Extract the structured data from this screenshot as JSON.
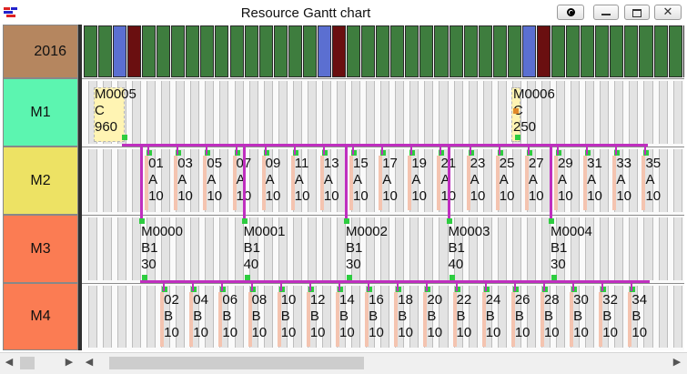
{
  "window": {
    "title": "Resource Gantt chart",
    "icons": [
      "app-icon",
      "diamond-icon",
      "minimize-icon",
      "maximize-icon",
      "close-icon"
    ]
  },
  "rows": [
    {
      "label": "2016",
      "color": "#b5865f"
    },
    {
      "label": "M1",
      "color": "#5cf5b0"
    },
    {
      "label": "M2",
      "color": "#ede264"
    },
    {
      "label": "M3",
      "color": "#fb7c53"
    },
    {
      "label": "M4",
      "color": "#fb7c53"
    }
  ],
  "calendar": {
    "colors": {
      "work": "#3e7d3e",
      "blue": "#5b6fd1",
      "maroon": "#6a0f10"
    },
    "pattern": [
      "work",
      "work",
      "blue",
      "maroon",
      "work",
      "work",
      "work",
      "work",
      "work",
      "work",
      "work",
      "work",
      "work",
      "work",
      "work",
      "work",
      "blue",
      "maroon",
      "work",
      "work",
      "work",
      "work",
      "work",
      "work",
      "work",
      "work",
      "work",
      "work",
      "work",
      "work",
      "blue",
      "maroon",
      "work",
      "work",
      "work",
      "work",
      "work",
      "work",
      "work",
      "work",
      "work",
      "work",
      "work",
      "work",
      "blue",
      "maroon",
      "work",
      "work",
      "work",
      "work",
      "work",
      "work",
      "work",
      "work",
      "work",
      "work",
      "work",
      "work",
      "blue",
      "maroon",
      "work",
      "work",
      "work",
      "work",
      "work",
      "work",
      "work",
      "work",
      "work",
      "work",
      "work",
      "work",
      "blue",
      "maroon",
      "work",
      "work",
      "work",
      "work",
      "work",
      "work",
      "work",
      "work",
      "work",
      "work",
      "work"
    ]
  },
  "jobs": {
    "m1": [
      {
        "lines": [
          "M0005",
          "C",
          "960"
        ]
      },
      {
        "lines": [
          "M0006",
          "C",
          "250"
        ]
      }
    ],
    "m2": [
      {
        "lines": [
          "01",
          "A",
          "10"
        ]
      },
      {
        "lines": [
          "03",
          "A",
          "10"
        ]
      },
      {
        "lines": [
          "05",
          "A",
          "10"
        ]
      },
      {
        "lines": [
          "07",
          "A",
          "10"
        ]
      },
      {
        "lines": [
          "09",
          "A",
          "10"
        ]
      },
      {
        "lines": [
          "11",
          "A",
          "10"
        ]
      },
      {
        "lines": [
          "13",
          "A",
          "10"
        ]
      },
      {
        "lines": [
          "15",
          "A",
          "10"
        ]
      },
      {
        "lines": [
          "17",
          "A",
          "10"
        ]
      },
      {
        "lines": [
          "19",
          "A",
          "10"
        ]
      },
      {
        "lines": [
          "21",
          "A",
          "10"
        ]
      },
      {
        "lines": [
          "23",
          "A",
          "10"
        ]
      },
      {
        "lines": [
          "25",
          "A",
          "10"
        ]
      },
      {
        "lines": [
          "27",
          "A",
          "10"
        ]
      },
      {
        "lines": [
          "29",
          "A",
          "10"
        ]
      },
      {
        "lines": [
          "31",
          "A",
          "10"
        ]
      },
      {
        "lines": [
          "33",
          "A",
          "10"
        ]
      },
      {
        "lines": [
          "35",
          "A",
          "10"
        ]
      }
    ],
    "m3": [
      {
        "lines": [
          "M0000",
          "B1",
          "30"
        ]
      },
      {
        "lines": [
          "M0001",
          "B1",
          "40"
        ]
      },
      {
        "lines": [
          "M0002",
          "B1",
          "30"
        ]
      },
      {
        "lines": [
          "M0003",
          "B1",
          "40"
        ]
      },
      {
        "lines": [
          "M0004",
          "B1",
          "30"
        ]
      }
    ],
    "m4": [
      {
        "lines": [
          "02",
          "B",
          "10"
        ]
      },
      {
        "lines": [
          "04",
          "B",
          "10"
        ]
      },
      {
        "lines": [
          "06",
          "B",
          "10"
        ]
      },
      {
        "lines": [
          "08",
          "B",
          "10"
        ]
      },
      {
        "lines": [
          "10",
          "B",
          "10"
        ]
      },
      {
        "lines": [
          "12",
          "B",
          "10"
        ]
      },
      {
        "lines": [
          "14",
          "B",
          "10"
        ]
      },
      {
        "lines": [
          "16",
          "B",
          "10"
        ]
      },
      {
        "lines": [
          "18",
          "B",
          "10"
        ]
      },
      {
        "lines": [
          "20",
          "B",
          "10"
        ]
      },
      {
        "lines": [
          "22",
          "B",
          "10"
        ]
      },
      {
        "lines": [
          "24",
          "B",
          "10"
        ]
      },
      {
        "lines": [
          "26",
          "B",
          "10"
        ]
      },
      {
        "lines": [
          "28",
          "B",
          "10"
        ]
      },
      {
        "lines": [
          "30",
          "B",
          "10"
        ]
      },
      {
        "lines": [
          "32",
          "B",
          "10"
        ]
      },
      {
        "lines": [
          "34",
          "B",
          "10"
        ]
      }
    ]
  },
  "colors": {
    "link": "#bf2fbf",
    "node": "#2ecc40",
    "duration_bar": "#f4c4b0",
    "setup_bar": "#fff4b3"
  }
}
